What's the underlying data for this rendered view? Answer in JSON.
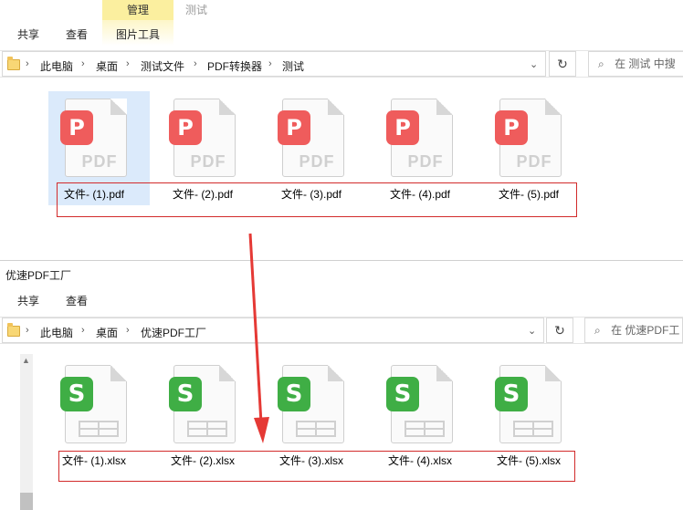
{
  "window1": {
    "title": "测试",
    "context_tab": "管理",
    "context_tab_sub": "图片工具",
    "tabs": [
      "共享",
      "查看"
    ],
    "breadcrumb": [
      "此电脑",
      "桌面",
      "测试文件",
      "PDF转换器",
      "测试"
    ],
    "search_placeholder": "在 测试 中搜",
    "files": [
      {
        "name": "文件- (1).pdf",
        "badge": "P",
        "label": "PDF"
      },
      {
        "name": "文件- (2).pdf",
        "badge": "P",
        "label": "PDF"
      },
      {
        "name": "文件- (3).pdf",
        "badge": "P",
        "label": "PDF"
      },
      {
        "name": "文件- (4).pdf",
        "badge": "P",
        "label": "PDF"
      },
      {
        "name": "文件- (5).pdf",
        "badge": "P",
        "label": "PDF"
      }
    ]
  },
  "window2": {
    "title": "优速PDF工厂",
    "tabs": [
      "共享",
      "查看"
    ],
    "breadcrumb": [
      "此电脑",
      "桌面",
      "优速PDF工厂"
    ],
    "search_placeholder": "在 优速PDF工",
    "files": [
      {
        "name": "文件- (1).xlsx",
        "badge": "S"
      },
      {
        "name": "文件- (2).xlsx",
        "badge": "S"
      },
      {
        "name": "文件- (3).xlsx",
        "badge": "S"
      },
      {
        "name": "文件- (4).xlsx",
        "badge": "S"
      },
      {
        "name": "文件- (5).xlsx",
        "badge": "S"
      }
    ]
  },
  "colors": {
    "pdf_badge": "#ef5c5c",
    "xlsx_badge": "#3fae45",
    "highlight_box": "#d22b2b",
    "arrow": "#e53935",
    "context_tab": "#fbef9f"
  }
}
